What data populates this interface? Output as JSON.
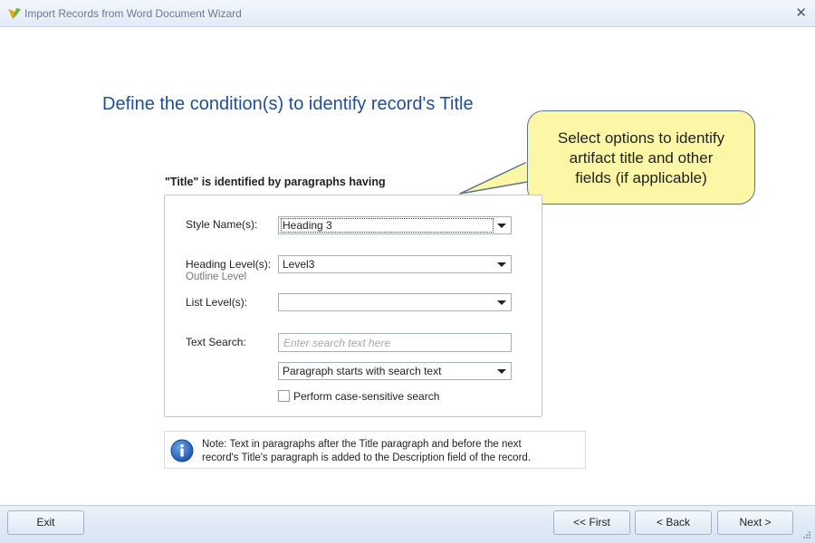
{
  "window": {
    "title": "Import Records from Word Document Wizard",
    "close_glyph": "✕"
  },
  "page": {
    "heading": "Define the condition(s) to identify record's Title"
  },
  "callout": {
    "line1": "Select options to identify",
    "line2": "artifact title and other",
    "line3": "fields (if applicable)",
    "fill_color": "#fcf7a6"
  },
  "group": {
    "label": "\"Title\" is identified by paragraphs having"
  },
  "fields": {
    "style_name": {
      "label": "Style Name(s):",
      "value": "Heading 3"
    },
    "heading_level": {
      "label": "Heading Level(s):",
      "sublabel": "Outline Level",
      "value": "Level3"
    },
    "list_level": {
      "label": "List Level(s):",
      "value": ""
    },
    "text_search": {
      "label": "Text Search:",
      "value": "",
      "placeholder": "Enter search text here"
    },
    "search_mode": {
      "value": "Paragraph starts with search text"
    },
    "case_sensitive": {
      "label": "Perform case-sensitive search",
      "checked": false
    }
  },
  "note": {
    "line1": "Note: Text in paragraphs after the Title paragraph and before the next",
    "line2": "record's Title's paragraph is added to the Description field of the record.",
    "icon": "info-icon"
  },
  "footer": {
    "exit_label": "Exit",
    "first_label": "<< First",
    "back_label": "< Back",
    "next_label": "Next >"
  },
  "colors": {
    "heading": "#1f4e9b",
    "footer_bg": "#dde8f4",
    "info_icon": "#2a68c2"
  }
}
